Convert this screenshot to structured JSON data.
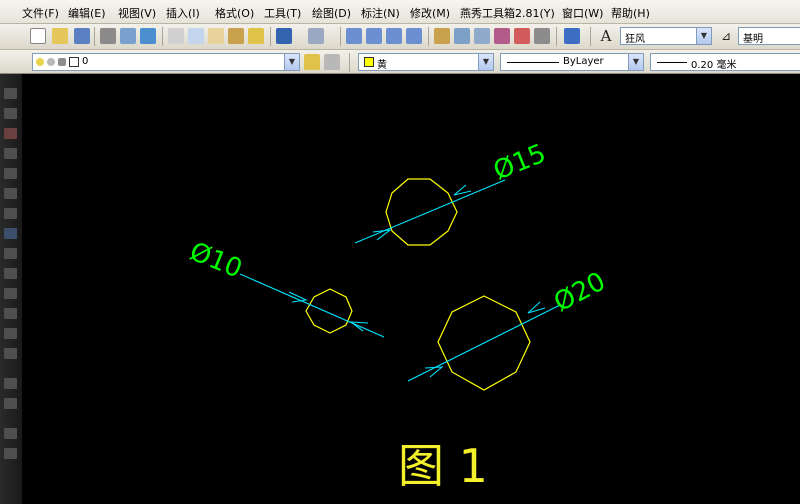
{
  "menu": [
    {
      "key": "file",
      "label": "文件(F)"
    },
    {
      "key": "edit",
      "label": "编辑(E)"
    },
    {
      "key": "view",
      "label": "视图(V)"
    },
    {
      "key": "insert",
      "label": "插入(I)"
    },
    {
      "key": "format",
      "label": "格式(O)"
    },
    {
      "key": "tools",
      "label": "工具(T)"
    },
    {
      "key": "draw",
      "label": "绘图(D)"
    },
    {
      "key": "dimension",
      "label": "标注(N)"
    },
    {
      "key": "modify",
      "label": "修改(M)"
    },
    {
      "key": "yanxiu",
      "label": "燕秀工具箱2.81(Y)"
    },
    {
      "key": "window",
      "label": "窗口(W)"
    },
    {
      "key": "help",
      "label": "帮助(H)"
    }
  ],
  "toolbar": {
    "textstyle_value": "狂风",
    "dimstyle_value": "基明"
  },
  "properties": {
    "layer_value": "0",
    "color_value": "黄",
    "linetype_value": "ByLayer",
    "lineweight_value": "0.20 毫米"
  },
  "drawing": {
    "dim_labels": [
      "Ø15",
      "Ø10",
      "Ø20"
    ],
    "caption": "图 1",
    "colors": {
      "geometry": "#ffff00",
      "dimension": "#00e5ff",
      "dim_text": "#00ff00",
      "caption": "#f3ef2a"
    }
  }
}
